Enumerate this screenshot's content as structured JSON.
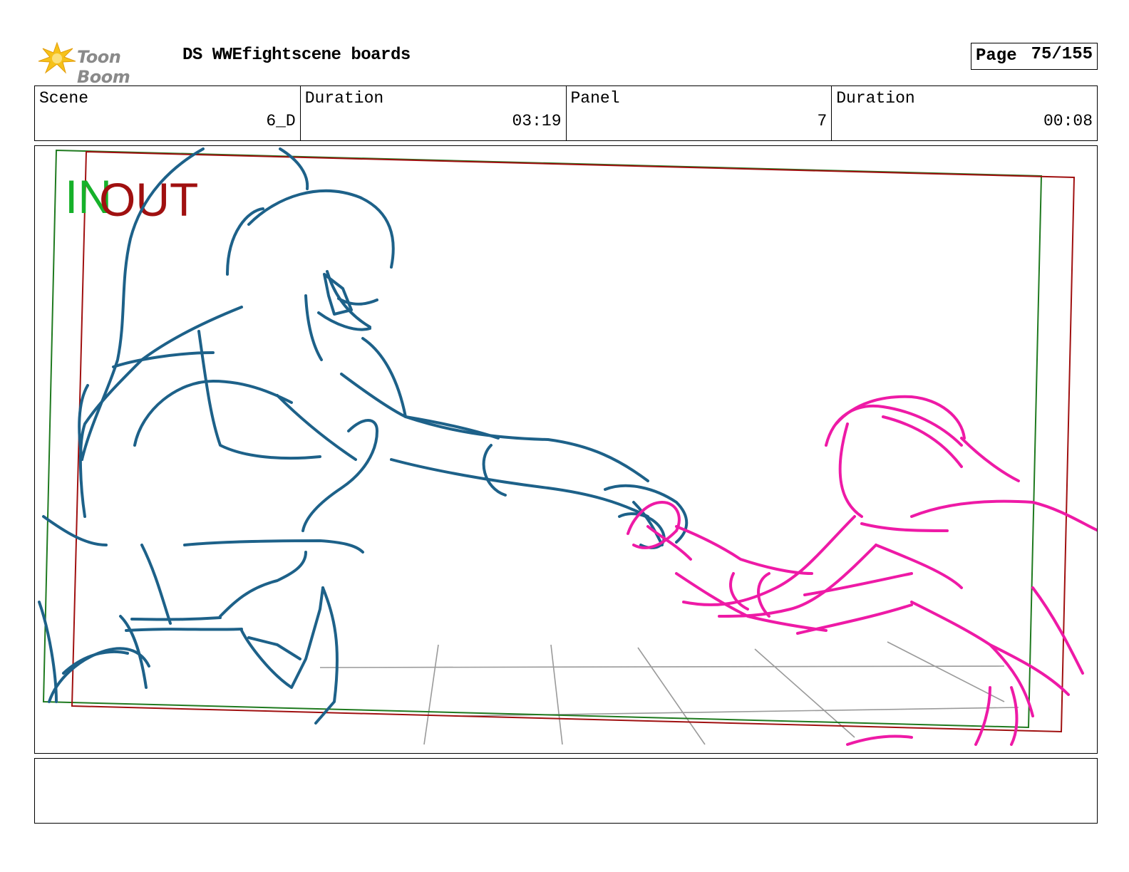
{
  "header": {
    "logo_text": "Toon Boom",
    "title": "DS WWEfightscene boards",
    "page_label": "Page",
    "page_value": "75/155"
  },
  "info": [
    {
      "label": "Scene",
      "value": "6_D"
    },
    {
      "label": "Duration",
      "value": "03:19"
    },
    {
      "label": "Panel",
      "value": "7"
    },
    {
      "label": "Duration",
      "value": "00:08"
    }
  ],
  "panel": {
    "marker_in": "IN",
    "marker_out": "OUT",
    "colors": {
      "in_frame": "#1f7a1f",
      "out_frame": "#a01010",
      "character_a": "#1d6189",
      "character_b": "#ee1aa6",
      "floor_lines": "#9a9a9a"
    }
  },
  "notes": {
    "text": ""
  }
}
